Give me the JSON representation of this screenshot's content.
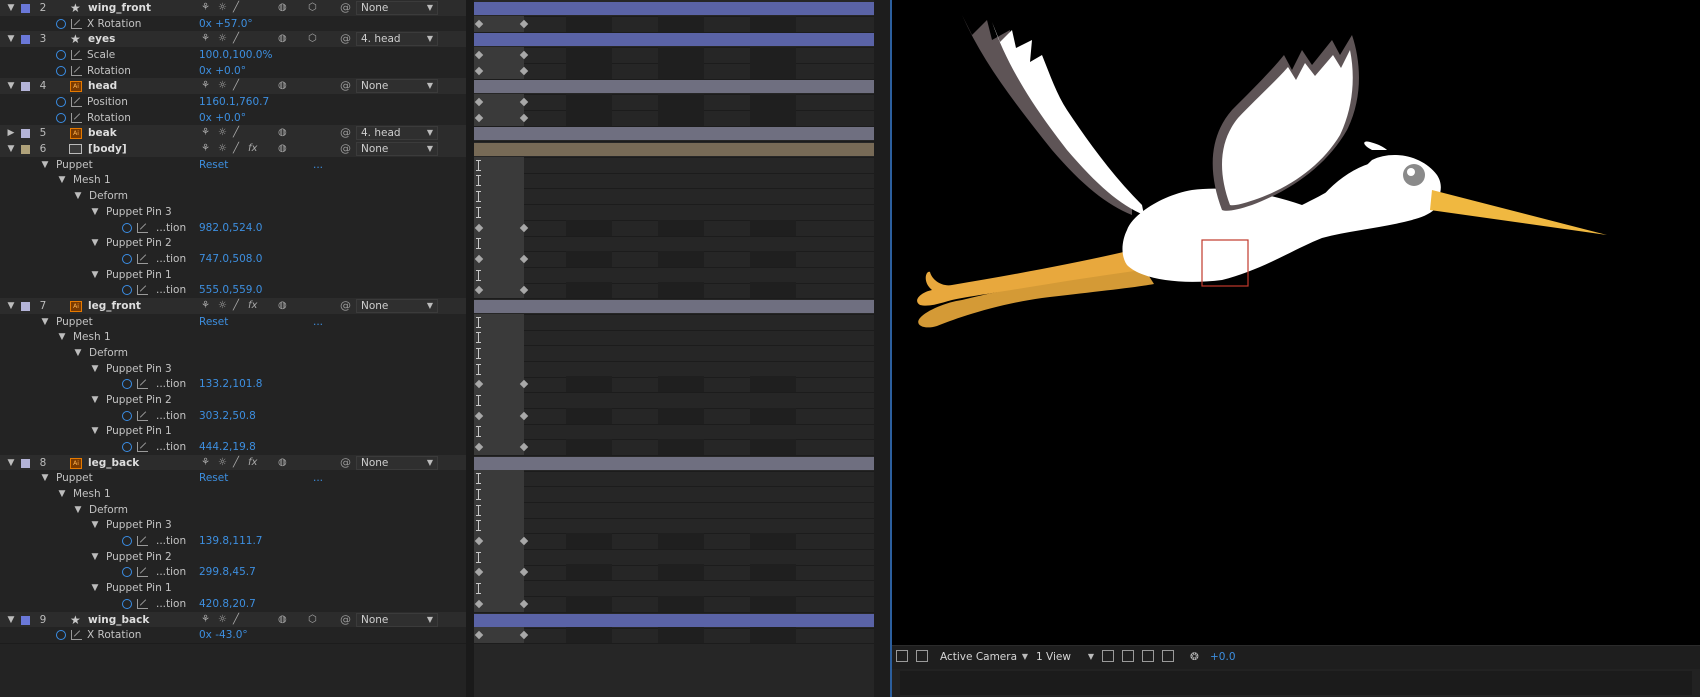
{
  "layers": [
    {
      "num": "2",
      "name": "wing_front",
      "label_color": "#6a78d8",
      "icon": "star-icon",
      "parent": "None",
      "bar_color": "#5a63a6",
      "props": [
        {
          "name": "X Rotation",
          "value": "0x +57.0°",
          "indent": 0
        }
      ]
    },
    {
      "num": "3",
      "name": "eyes",
      "label_color": "#6a78d8",
      "icon": "star-icon",
      "parent": "4. head",
      "bar_color": "#5a63a6",
      "props": [
        {
          "name": "Scale",
          "value": "100.0,100.0%",
          "indent": 0
        },
        {
          "name": "Rotation",
          "value": "0x +0.0°",
          "indent": 0
        }
      ]
    },
    {
      "num": "4",
      "name": "head",
      "label_color": "#b4b4d8",
      "icon": "ai-file-icon",
      "parent": "None",
      "bar_color": "#6f6f80",
      "props": [
        {
          "name": "Position",
          "value": "1160.1,760.7",
          "indent": 0
        },
        {
          "name": "Rotation",
          "value": "0x +0.0°",
          "indent": 0
        }
      ]
    },
    {
      "num": "5",
      "name": "beak",
      "label_color": "#b4b4d8",
      "icon": "ai-file-icon",
      "parent": "4. head",
      "bar_color": "#6f6f80",
      "collapsed": true,
      "props": []
    },
    {
      "num": "6",
      "name": "[body]",
      "label_color": "#b0a27a",
      "icon": "composition-icon",
      "parent": "None",
      "bar_color": "#776a56",
      "fx": true,
      "puppet": {
        "reset": "Reset",
        "dots": "...",
        "mesh": "Mesh 1",
        "deform": "Deform",
        "pins": [
          {
            "name": "Puppet Pin 3",
            "value": "982.0,524.0"
          },
          {
            "name": "Puppet Pin 2",
            "value": "747.0,508.0"
          },
          {
            "name": "Puppet Pin 1",
            "value": "555.0,559.0"
          }
        ]
      }
    },
    {
      "num": "7",
      "name": "leg_front",
      "label_color": "#b4b4d8",
      "icon": "ai-file-icon",
      "parent": "None",
      "bar_color": "#6f6f80",
      "fx": true,
      "puppet": {
        "reset": "Reset",
        "dots": "...",
        "mesh": "Mesh 1",
        "deform": "Deform",
        "pins": [
          {
            "name": "Puppet Pin 3",
            "value": "133.2,101.8"
          },
          {
            "name": "Puppet Pin 2",
            "value": "303.2,50.8"
          },
          {
            "name": "Puppet Pin 1",
            "value": "444.2,19.8"
          }
        ]
      }
    },
    {
      "num": "8",
      "name": "leg_back",
      "label_color": "#b4b4d8",
      "icon": "ai-file-icon",
      "parent": "None",
      "bar_color": "#6f6f80",
      "fx": true,
      "puppet": {
        "reset": "Reset",
        "dots": "...",
        "mesh": "Mesh 1",
        "deform": "Deform",
        "pins": [
          {
            "name": "Puppet Pin 3",
            "value": "139.8,111.7"
          },
          {
            "name": "Puppet Pin 2",
            "value": "299.8,45.7"
          },
          {
            "name": "Puppet Pin 1",
            "value": "420.8,20.7"
          }
        ]
      }
    },
    {
      "num": "9",
      "name": "wing_back",
      "label_color": "#6a78d8",
      "icon": "star-icon",
      "parent": "None",
      "bar_color": "#5a63a6",
      "props": [
        {
          "name": "X Rotation",
          "value": "0x -43.0°",
          "indent": 0
        }
      ]
    }
  ],
  "strings": {
    "puppet": "Puppet",
    "pin_prop": "...tion"
  },
  "viewer": {
    "camera": "Active Camera",
    "views": "1 View",
    "exposure": "+0.0"
  }
}
